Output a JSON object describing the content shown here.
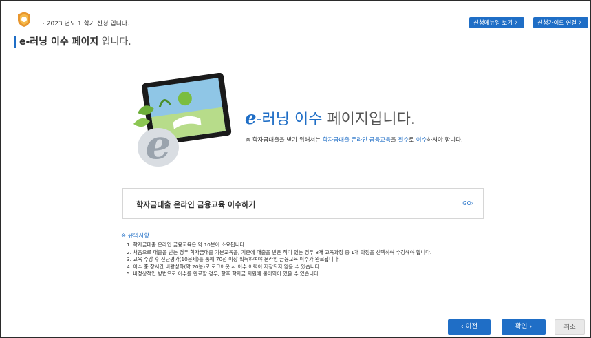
{
  "header": {
    "semester_text": "· 2023 년도 1 학기 신청 입니다.",
    "manual_button": "신청메뉴얼 보기 〉",
    "guide_button": "신청가이드 연결 〉"
  },
  "page": {
    "title_bold": "e-러닝 이수 페이지",
    "title_suffix": " 입니다."
  },
  "hero": {
    "headline_e": "e",
    "headline_mid": "-러닝 이수",
    "headline_end": " 페이지입니다.",
    "note_prefix": "※ 학자금대출을 받기 위해서는 ",
    "note_highlight1": "학자금대출 온라인 금융교육",
    "note_mid1": "을 ",
    "note_highlight2": "필수",
    "note_mid2": "로 ",
    "note_highlight3": "이수",
    "note_suffix": "하셔야 합니다."
  },
  "course": {
    "label": "학자금대출 온라인 금융교육 이수하기",
    "go": "GO›"
  },
  "notice": {
    "title": "※ 유의사항",
    "items": [
      "1. 학자금대출 온라인 금융교육은 약 10분이 소요됩니다.",
      "2. 처음으로 대출을 받는 경우 학자금대출 기본교육을, 기존에 대출을 받은 적이 있는 경우 8개 교육과정 중 1개 과정을 선택하여 수강해야 합니다.",
      "3. 교육 수강 후 진단평가(10문제)를 통해 70점 이상 획득하여야 온라인 금융교육 이수가 완료됩니다.",
      "4. 이수 중 장시간 비활성화(약 20분)로 로그아웃 시 이수 이력이 저장되지 않을 수 있습니다.",
      "5. 비정상적인 방법으로 이수를 완료할 경우, 향후 학자금 지원에 불이익이 있을 수 있습니다."
    ]
  },
  "footer": {
    "prev": "‹ 이전",
    "ok": "확인 ›",
    "cancel": "취소"
  },
  "colors": {
    "accent": "#1f6ec6"
  }
}
